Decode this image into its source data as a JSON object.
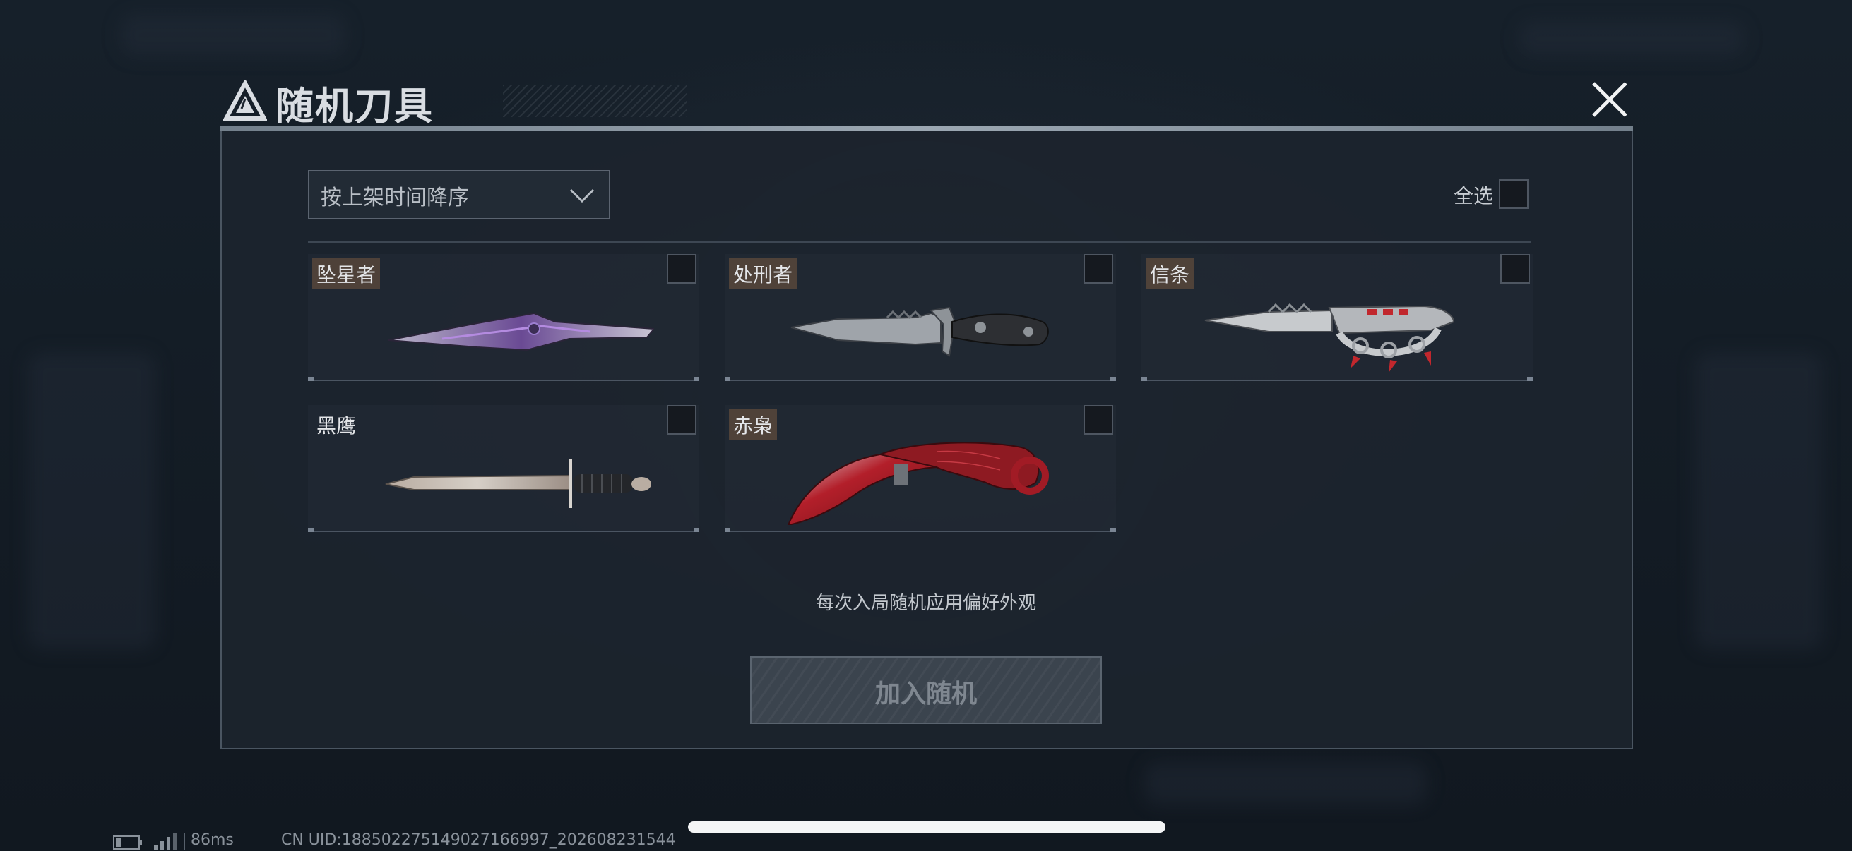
{
  "header": {
    "title": "随机刀具"
  },
  "sort": {
    "selected": "按上架时间降序"
  },
  "select_all": {
    "label": "全选",
    "checked": false
  },
  "knives": [
    {
      "name": "坠星者",
      "checked": false
    },
    {
      "name": "处刑者",
      "checked": false
    },
    {
      "name": "信条",
      "checked": false
    },
    {
      "name": "黑鹰",
      "checked": false
    },
    {
      "name": "赤枭",
      "checked": false
    }
  ],
  "hint": "每次入局随机应用偏好外观",
  "add_button": {
    "label": "加入随机"
  },
  "status": {
    "ping": "86ms",
    "uid": "CN UID:1885022751490271669​97_202608231544"
  },
  "colors": {
    "panel_bg": "#1c242e",
    "name_tag_bg": "#5f4b3c",
    "button_disabled": "#3b444e",
    "accent_line": "#aab6c1"
  }
}
